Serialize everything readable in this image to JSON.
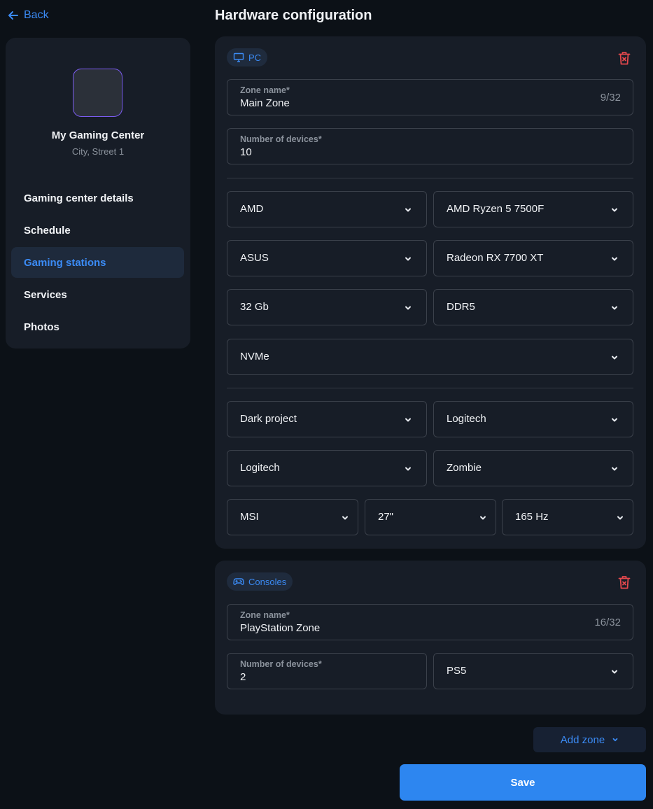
{
  "nav_back": {
    "label": "Back"
  },
  "sidebar": {
    "center_name": "My Gaming Center",
    "center_address": "City, Street 1",
    "items": [
      {
        "label": "Gaming center details",
        "active": false
      },
      {
        "label": "Schedule",
        "active": false
      },
      {
        "label": "Gaming stations",
        "active": true
      },
      {
        "label": "Services",
        "active": false
      },
      {
        "label": "Photos",
        "active": false
      }
    ]
  },
  "page_title": "Hardware configuration",
  "zones": [
    {
      "type_label": "PC",
      "type_icon": "monitor-icon",
      "zone_name_label": "Zone name*",
      "zone_name_value": "Main Zone",
      "zone_name_count": "9/32",
      "devices_label": "Number of devices*",
      "devices_value": "10",
      "cpu_brand": "AMD",
      "cpu_model": "AMD Ryzen 5 7500F",
      "gpu_brand": "ASUS",
      "gpu_model": "Radeon RX 7700 XT",
      "ram_size": "32 Gb",
      "ram_type": "DDR5",
      "storage": "NVMe",
      "headset": "Dark project",
      "keyboard": "Logitech",
      "mouse": "Logitech",
      "chair": "Zombie",
      "monitor_brand": "MSI",
      "monitor_size": "27\"",
      "monitor_refresh": "165 Hz"
    },
    {
      "type_label": "Consoles",
      "type_icon": "gamepad-icon",
      "zone_name_label": "Zone name*",
      "zone_name_value": "PlayStation Zone",
      "zone_name_count": "16/32",
      "devices_label": "Number of devices*",
      "devices_value": "2",
      "console_model": "PS5"
    }
  ],
  "actions": {
    "add_zone_label": "Add zone",
    "save_label": "Save"
  },
  "colors": {
    "accent": "#3b8bf5",
    "delete": "#e5484d",
    "background": "#0c1117",
    "card": "#171d27"
  }
}
